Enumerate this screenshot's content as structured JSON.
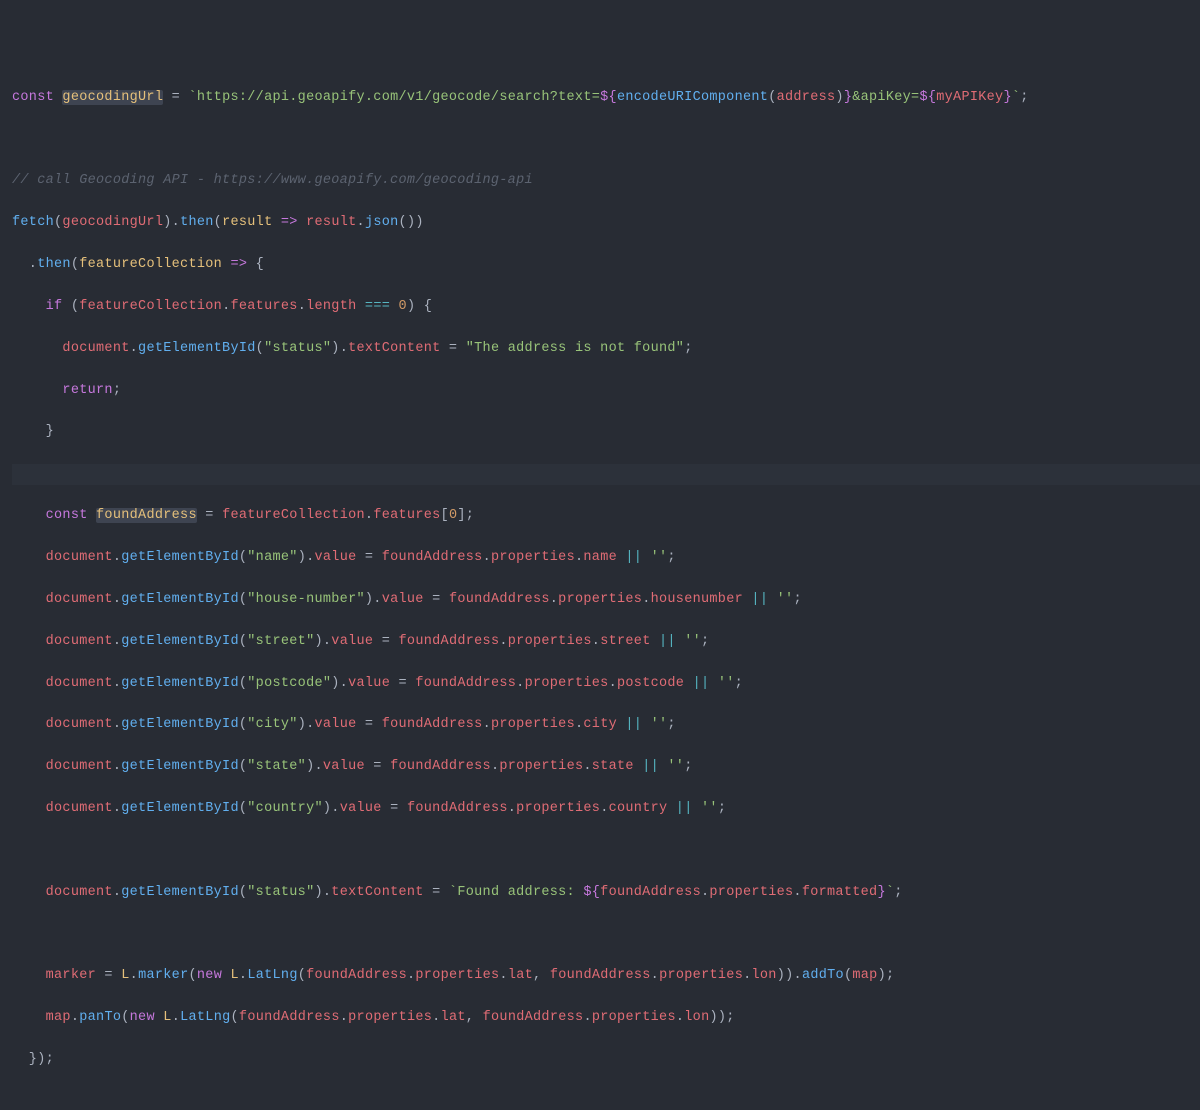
{
  "code": {
    "l1": {
      "const": "const",
      "var": "geocodingUrl",
      "eq": " = ",
      "str1": "`https://api.geoapify.com/v1/geocode/search?text=",
      "interp1o": "${",
      "fn": "encodeURIComponent",
      "paren1": "(",
      "arg": "address",
      "paren2": ")",
      "interp1c": "}",
      "str2": "&apiKey=",
      "interp2o": "${",
      "var2": "myAPIKey",
      "interp2c": "}",
      "str3": "`",
      "semi": ";"
    },
    "l3": "// call Geocoding API - https://www.geoapify.com/geocoding-api",
    "l4": {
      "fetch": "fetch",
      "p1": "(",
      "arg": "geocodingUrl",
      "p2": ").",
      "then": "then",
      "p3": "(",
      "res": "result",
      "arrow": " => ",
      "res2": "result",
      "dot": ".",
      "json": "json",
      "p4": "())"
    },
    "l5": {
      "pre": "  .",
      "then": "then",
      "p1": "(",
      "fc": "featureCollection",
      "arrow": " => ",
      "brace": "{"
    },
    "l6": {
      "pre": "    ",
      "if": "if",
      "p1": " (",
      "fc": "featureCollection",
      "d1": ".",
      "feat": "features",
      "d2": ".",
      "len": "length",
      "eq": " === ",
      "zero": "0",
      "p2": ") {"
    },
    "l7": {
      "pre": "      ",
      "doc": "document",
      "d1": ".",
      "gebi": "getElementById",
      "p1": "(",
      "str": "\"status\"",
      "p2": ").",
      "tc": "textContent",
      "eq": " = ",
      "msg": "\"The address is not found\"",
      "semi": ";"
    },
    "l8": {
      "pre": "      ",
      "ret": "return",
      "semi": ";"
    },
    "l9": "    }",
    "l11": {
      "pre": "    ",
      "const": "const",
      "sp": " ",
      "var": "foundAddress",
      "eq": " = ",
      "fc": "featureCollection",
      "d1": ".",
      "feat": "features",
      "br1": "[",
      "zero": "0",
      "br2": "];"
    },
    "l12": {
      "id": "\"name\"",
      "prop": "name"
    },
    "l13": {
      "id": "\"house-number\"",
      "prop": "housenumber"
    },
    "l14": {
      "id": "\"street\"",
      "prop": "street"
    },
    "l15": {
      "id": "\"postcode\"",
      "prop": "postcode"
    },
    "l16": {
      "id": "\"city\"",
      "prop": "city"
    },
    "l17": {
      "id": "\"state\"",
      "prop": "state"
    },
    "l18": {
      "id": "\"country\"",
      "prop": "country"
    },
    "assign": {
      "pre": "    ",
      "doc": "document",
      "d": ".",
      "gebi": "getElementById",
      "p1": "(",
      "p2": ").",
      "val": "value",
      "eq": " = ",
      "fa": "foundAddress",
      "props": "properties",
      "or": " || ",
      "empty": "''",
      "semi": ";"
    },
    "l20": {
      "pre": "    ",
      "doc": "document",
      "d": ".",
      "gebi": "getElementById",
      "p1": "(",
      "id": "\"status\"",
      "p2": ").",
      "tc": "textContent",
      "eq": " = ",
      "s1": "`Found address: ",
      "io": "${",
      "fa": "foundAddress",
      "props": "properties",
      "fmt": "formatted",
      "ic": "}",
      "s2": "`",
      "semi": ";"
    },
    "l22": {
      "pre": "    ",
      "marker": "marker",
      "eq": " = ",
      "L": "L",
      "d": ".",
      "mk": "marker",
      "p1": "(",
      "new": "new",
      "sp": " ",
      "ll": "LatLng",
      "p2": "(",
      "fa": "foundAddress",
      "props": "properties",
      "lat": "lat",
      "c": ", ",
      "lon": "lon",
      "p3": ")).",
      "addTo": "addTo",
      "p4": "(",
      "map": "map",
      "p5": ");"
    },
    "l23": {
      "pre": "    ",
      "map": "map",
      "d": ".",
      "panTo": "panTo",
      "p1": "(",
      "new": "new",
      "sp": " ",
      "L": "L",
      "ll": "LatLng",
      "p2": "(",
      "fa": "foundAddress",
      "props": "properties",
      "lat": "lat",
      "c": ", ",
      "lon": "lon",
      "p3": "));"
    },
    "l24": "  });"
  }
}
